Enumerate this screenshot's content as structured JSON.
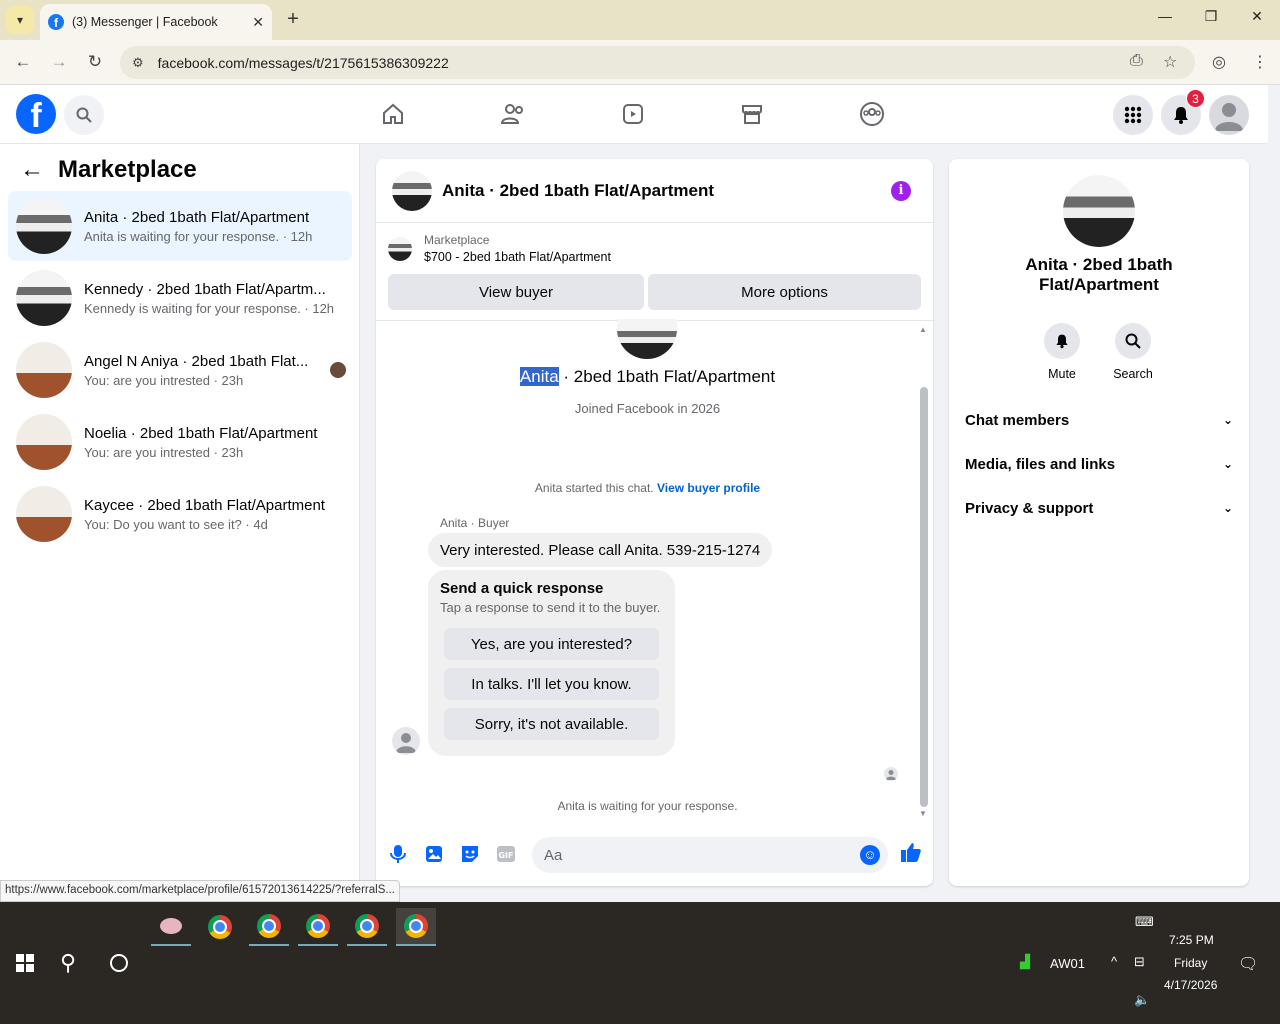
{
  "browser": {
    "tab_title": "(3) Messenger | Facebook",
    "url": "facebook.com/messages/t/2175615386309222",
    "status_url": "https://www.facebook.com/marketplace/profile/61572013614225/?referralS..."
  },
  "header": {
    "notification_count": "3"
  },
  "sidebar": {
    "title": "Marketplace",
    "conversations": [
      {
        "name": "Anita · 2bed 1bath Flat/Apartment",
        "preview": "Anita is waiting for your response. · 12h"
      },
      {
        "name": "Kennedy · 2bed 1bath Flat/Apartm...",
        "preview": "Kennedy is waiting for your response. · 12h"
      },
      {
        "name": "Angel N Aniya · 2bed 1bath Flat...",
        "preview": "You: are you intrested · 23h"
      },
      {
        "name": "Noelia · 2bed 1bath Flat/Apartment",
        "preview": "You: are you intrested · 23h"
      },
      {
        "name": "Kaycee · 2bed 1bath Flat/Apartment",
        "preview": "You: Do you want to see it? · 4d"
      }
    ]
  },
  "chat": {
    "title": "Anita · 2bed 1bath Flat/Apartment",
    "marketplace_label": "Marketplace",
    "listing": "$700 - 2bed 1bath Flat/Apartment",
    "view_buyer": "View buyer",
    "more_options": "More options",
    "profile_name_highlight": "Anita",
    "profile_name_rest": " · 2bed 1bath Flat/Apartment",
    "joined": "Joined Facebook in 2026",
    "started_text": "Anita started this chat. ",
    "view_buyer_profile": "View buyer profile",
    "sender_label": "Anita · Buyer",
    "message": "Very interested.  Please call Anita. 539-215-1274",
    "quick_title": "Send a quick response",
    "quick_sub": "Tap a response to send it to the buyer.",
    "quick_responses": [
      "Yes, are you interested?",
      "In talks. I'll let you know.",
      "Sorry, it's not available."
    ],
    "waiting": "Anita is waiting for your response.",
    "composer_placeholder": "Aa"
  },
  "details": {
    "name": "Anita · 2bed 1bath Flat/Apartment",
    "mute": "Mute",
    "search": "Search",
    "sections": [
      "Chat members",
      "Media, files and links",
      "Privacy & support"
    ]
  },
  "taskbar": {
    "network": "AW01",
    "time": "7:25 PM",
    "day": "Friday",
    "date": "4/17/2026"
  }
}
